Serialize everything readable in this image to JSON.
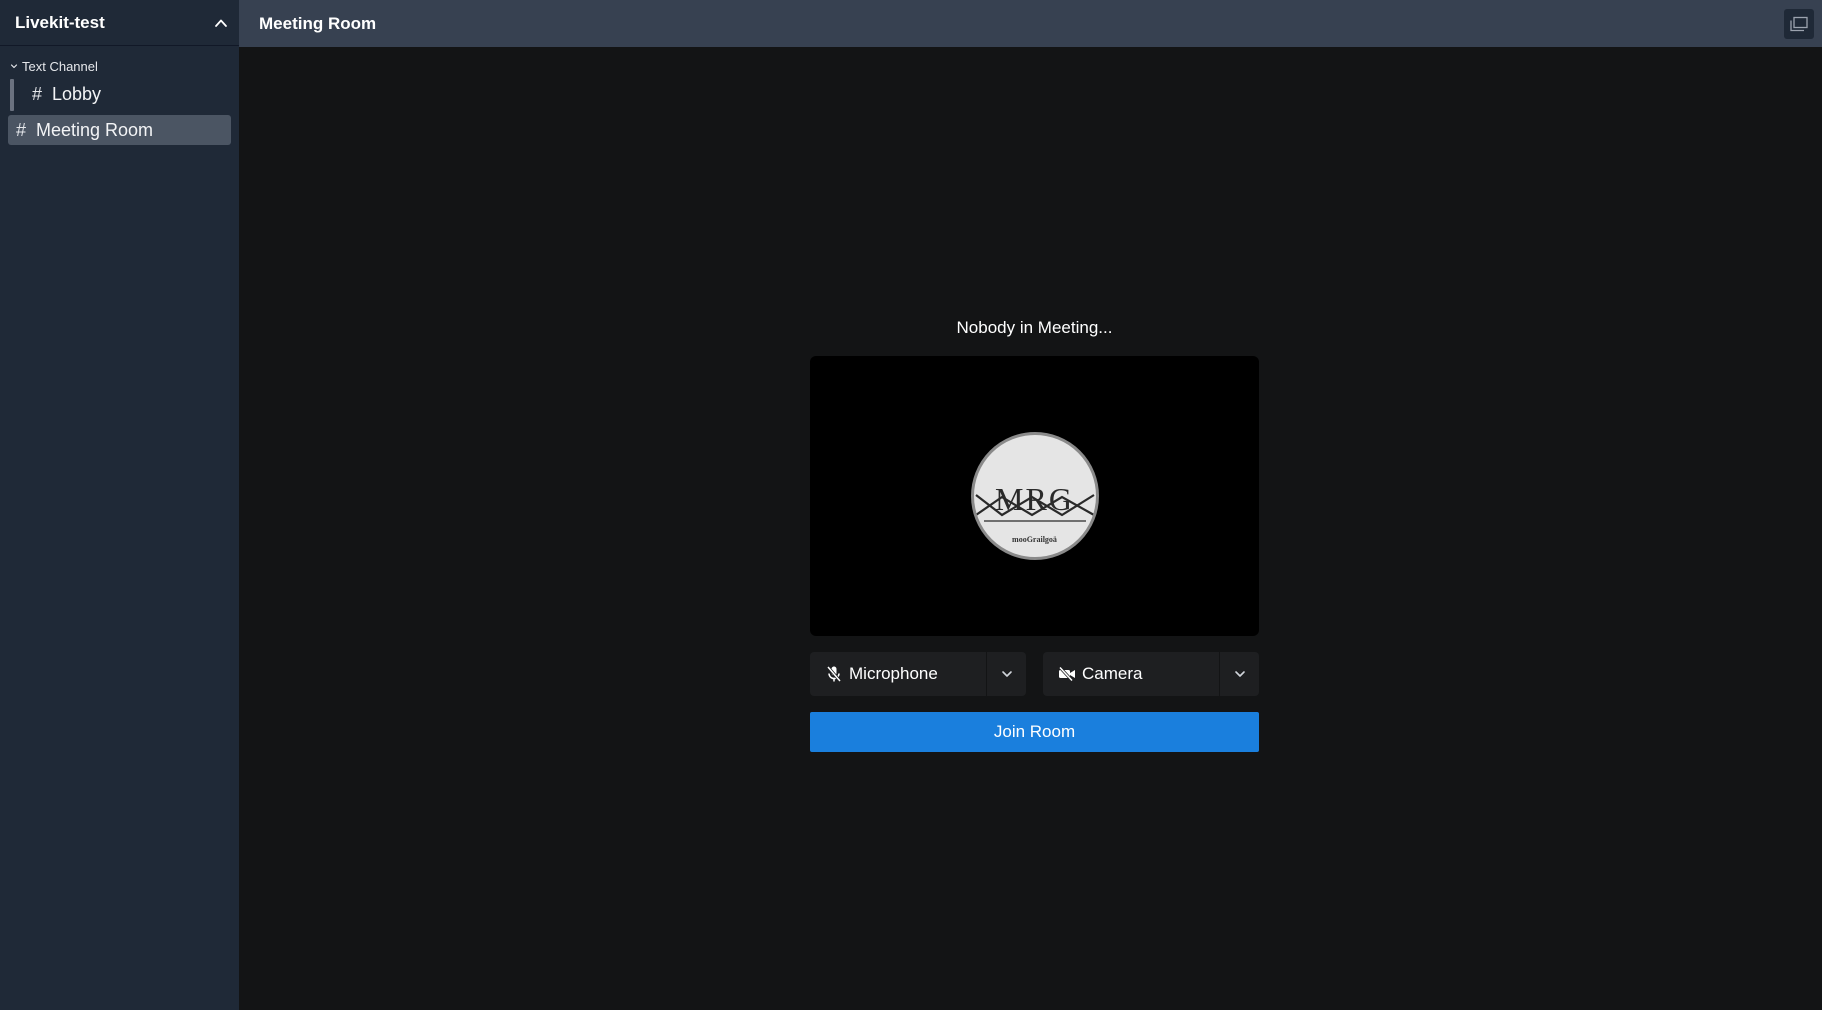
{
  "sidebar": {
    "server_name": "Livekit-test",
    "collapse_icon": "chevron-up-icon",
    "category": {
      "label": "Text Channel",
      "icon": "chevron-down-icon"
    },
    "channels": [
      {
        "hash": "#",
        "label": "Lobby",
        "active": false
      },
      {
        "hash": "#",
        "label": "Meeting Room",
        "active": true
      }
    ]
  },
  "topbar": {
    "title": "Meeting Room",
    "window_icon": "window-restore-icon"
  },
  "prejoin": {
    "status": "Nobody in Meeting...",
    "avatar": {
      "initials": "MRG",
      "subtext": "mooGrailgoä"
    },
    "microphone": {
      "label": "Microphone",
      "icon": "microphone-off-icon",
      "menu_icon": "chevron-down-icon"
    },
    "camera": {
      "label": "Camera",
      "icon": "camera-off-icon",
      "menu_icon": "chevron-down-icon"
    },
    "join_label": "Join Room"
  },
  "colors": {
    "sidebar_bg": "#1f2937",
    "topbar_bg": "#374151",
    "main_bg": "#131415",
    "active_channel_bg": "#4b5563",
    "join_button": "#1a7fdd"
  }
}
